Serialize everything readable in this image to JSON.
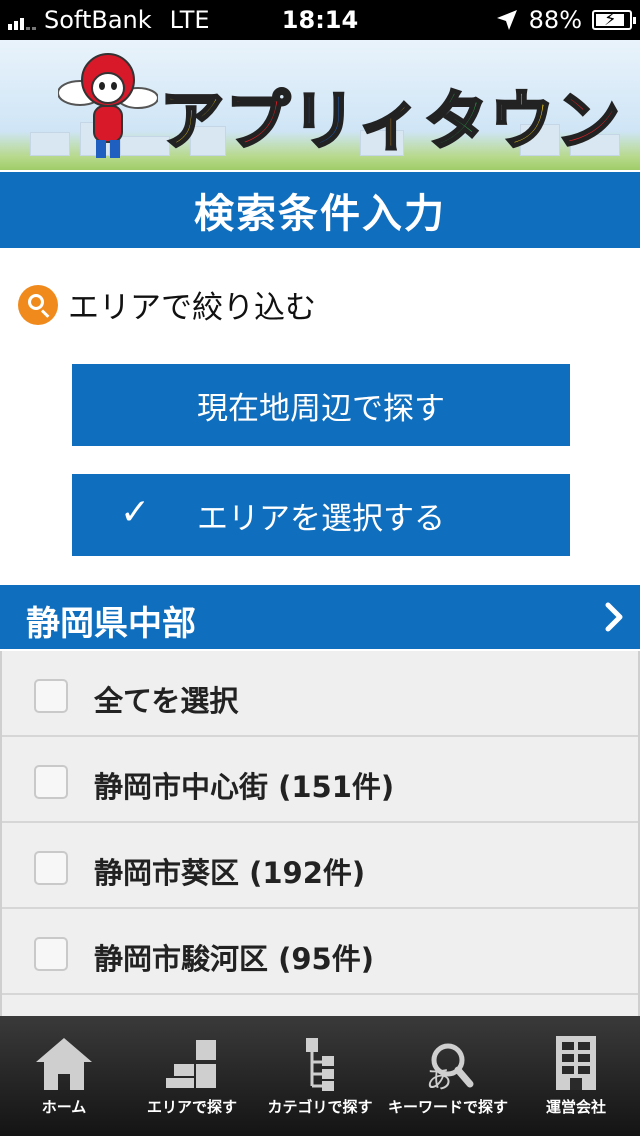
{
  "status_bar": {
    "carrier": "SoftBank",
    "network": "LTE",
    "time": "18:14",
    "battery_percent": "88%",
    "battery_level": 0.88
  },
  "banner": {
    "logo_chars": [
      {
        "char": "ア",
        "color": "#f7d21a"
      },
      {
        "char": "プ",
        "color": "#e01f26"
      },
      {
        "char": "リ",
        "color": "#1f5fbf"
      },
      {
        "char": "ィ",
        "color": "#f0a21a"
      },
      {
        "char": "タ",
        "color": "#2aa84a"
      },
      {
        "char": "ウ",
        "color": "#f7d21a"
      },
      {
        "char": "ン",
        "color": "#e01f26"
      }
    ]
  },
  "header": {
    "title": "検索条件入力"
  },
  "filter": {
    "heading": "エリアで絞り込む",
    "nearby_button": "現在地周辺で探す",
    "area_button": "エリアを選択する",
    "area_check": "✓"
  },
  "region": {
    "name": "静岡県中部"
  },
  "list": {
    "items": [
      {
        "label": "全てを選択"
      },
      {
        "label": "静岡市中心街 (151件)"
      },
      {
        "label": "静岡市葵区 (192件)"
      },
      {
        "label": "静岡市駿河区 (95件)"
      }
    ]
  },
  "tabs": [
    {
      "label": "ホーム",
      "icon": "home-icon"
    },
    {
      "label": "エリアで探す",
      "icon": "area-icon"
    },
    {
      "label": "カテゴリで探す",
      "icon": "category-icon"
    },
    {
      "label": "キーワードで探す",
      "icon": "keyword-search-icon"
    },
    {
      "label": "運営会社",
      "icon": "company-building-icon"
    }
  ],
  "colors": {
    "primary_blue": "#0f6ebe",
    "accent_orange": "#f08a1c"
  }
}
